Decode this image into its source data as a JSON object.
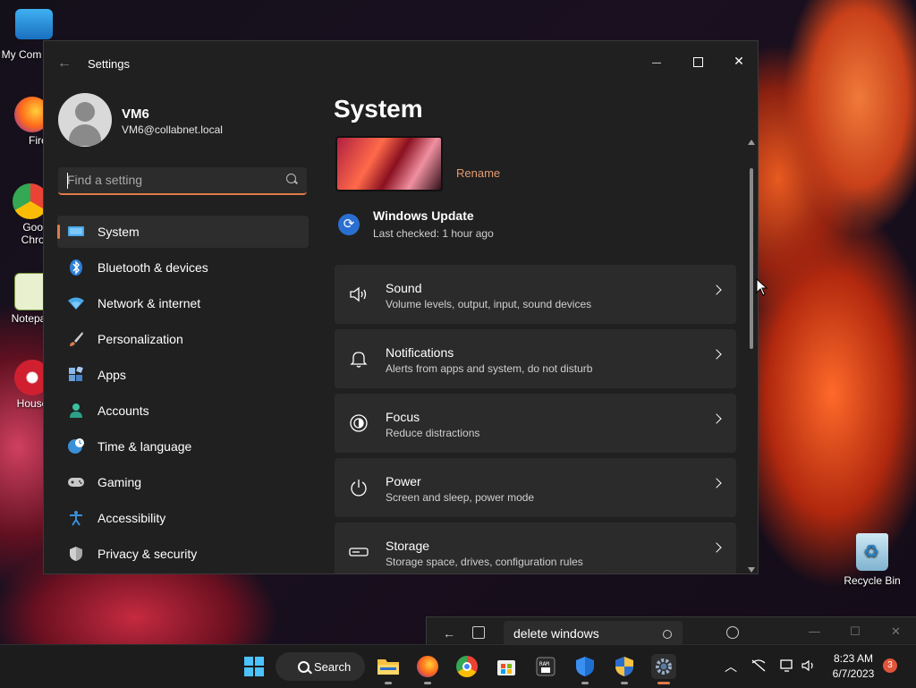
{
  "desktop": {
    "icons": [
      {
        "label": "My Com"
      },
      {
        "label": "Firef"
      },
      {
        "label": "Goog Chron"
      },
      {
        "label": "Notepa"
      },
      {
        "label": "House"
      }
    ],
    "recycle_bin": "Recycle Bin"
  },
  "window": {
    "title": "Settings",
    "controls": {
      "minimize": "—",
      "close": "✕"
    }
  },
  "user": {
    "name": "VM6",
    "email": "VM6@collabnet.local"
  },
  "search": {
    "placeholder": "Find a setting",
    "value": ""
  },
  "nav": {
    "items": [
      {
        "label": "System",
        "icon": "system-icon",
        "active": true
      },
      {
        "label": "Bluetooth & devices",
        "icon": "bluetooth-icon"
      },
      {
        "label": "Network & internet",
        "icon": "wifi-icon"
      },
      {
        "label": "Personalization",
        "icon": "brush-icon"
      },
      {
        "label": "Apps",
        "icon": "apps-icon"
      },
      {
        "label": "Accounts",
        "icon": "person-icon"
      },
      {
        "label": "Time & language",
        "icon": "globe-clock-icon"
      },
      {
        "label": "Gaming",
        "icon": "gamepad-icon"
      },
      {
        "label": "Accessibility",
        "icon": "accessibility-icon"
      },
      {
        "label": "Privacy & security",
        "icon": "shield-icon"
      }
    ]
  },
  "main": {
    "title": "System",
    "rename_label": "Rename",
    "windows_update": {
      "title": "Windows Update",
      "subtitle": "Last checked: 1 hour ago"
    },
    "cards": [
      {
        "title": "Sound",
        "subtitle": "Volume levels, output, input, sound devices",
        "icon": "speaker-icon"
      },
      {
        "title": "Notifications",
        "subtitle": "Alerts from apps and system, do not disturb",
        "icon": "bell-icon"
      },
      {
        "title": "Focus",
        "subtitle": "Reduce distractions",
        "icon": "focus-icon"
      },
      {
        "title": "Power",
        "subtitle": "Screen and sleep, power mode",
        "icon": "power-icon"
      },
      {
        "title": "Storage",
        "subtitle": "Storage space, drives, configuration rules",
        "icon": "storage-icon"
      }
    ]
  },
  "float_window": {
    "query": "delete windows"
  },
  "taskbar": {
    "search_label": "Search",
    "time": "8:23 AM",
    "date": "6/7/2023",
    "notification_count": "3"
  },
  "colors": {
    "accent": "#e07a4a",
    "window_bg": "#202020",
    "card_bg": "#2b2b2b"
  }
}
